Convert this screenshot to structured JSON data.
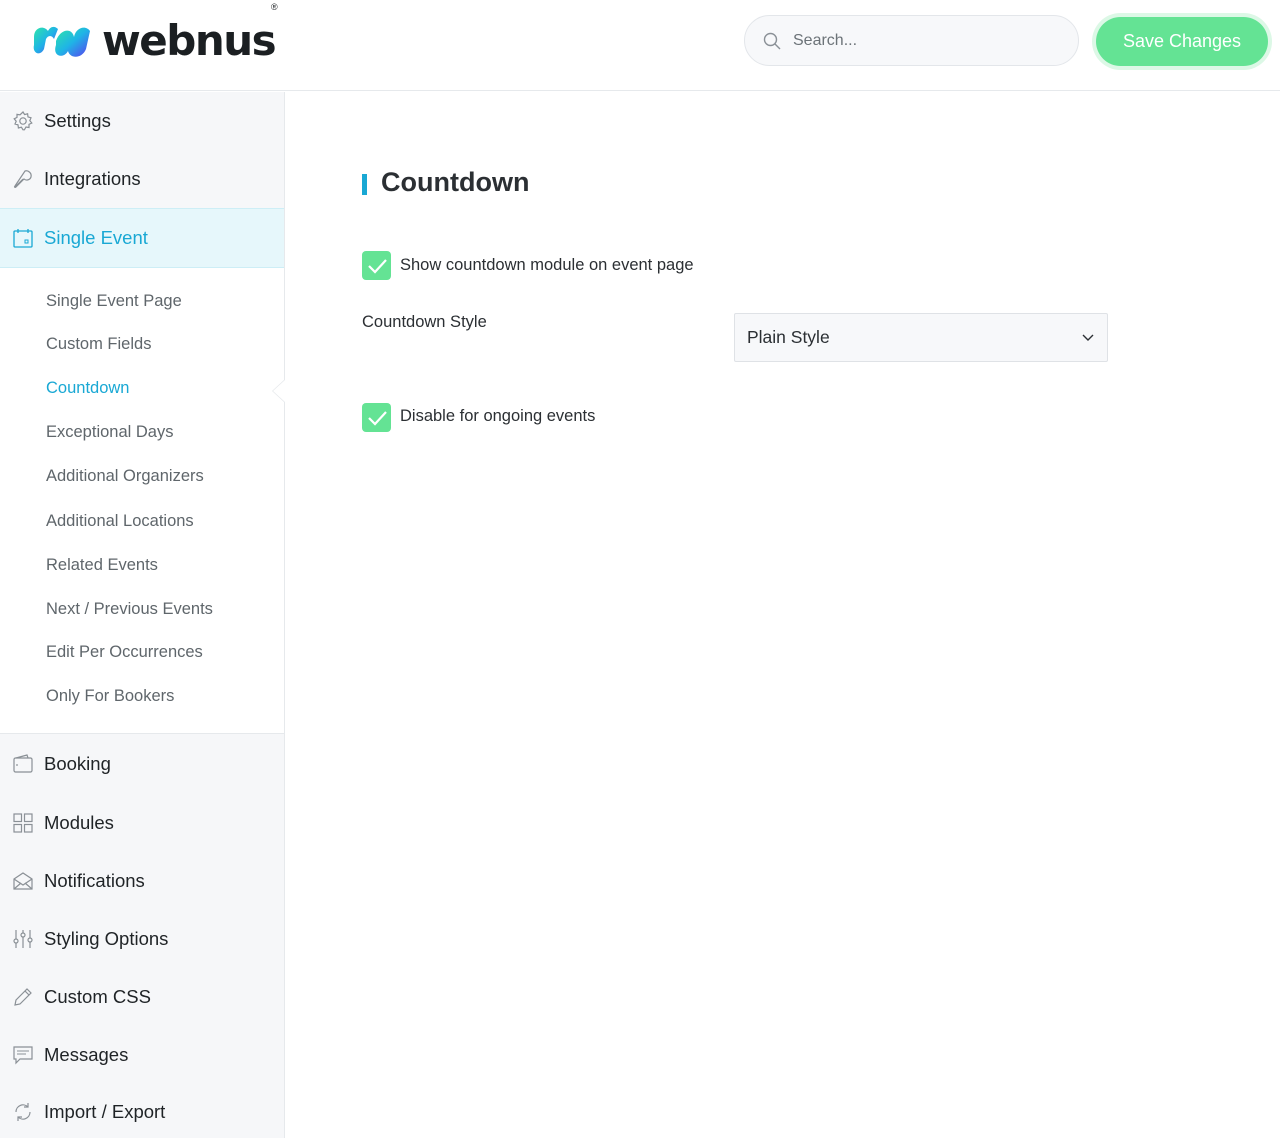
{
  "header": {
    "logo_text": "webnus",
    "logo_reg": "®",
    "search_placeholder": "Search...",
    "save_label": "Save Changes"
  },
  "sidebar": {
    "items_top": [
      {
        "label": "Settings",
        "icon": "gear-icon"
      },
      {
        "label": "Integrations",
        "icon": "wrench-icon"
      },
      {
        "label": "Single Event",
        "icon": "calendar-icon",
        "active": true
      }
    ],
    "submenu": [
      {
        "label": "Single Event Page"
      },
      {
        "label": "Custom Fields"
      },
      {
        "label": "Countdown",
        "active": true
      },
      {
        "label": "Exceptional Days"
      },
      {
        "label": "Additional Organizers"
      },
      {
        "label": "Additional Locations"
      },
      {
        "label": "Related Events"
      },
      {
        "label": "Next / Previous Events"
      },
      {
        "label": "Edit Per Occurrences"
      },
      {
        "label": "Only For Bookers"
      }
    ],
    "items_bottom": [
      {
        "label": "Booking",
        "icon": "wallet-icon"
      },
      {
        "label": "Modules",
        "icon": "grid-icon"
      },
      {
        "label": "Notifications",
        "icon": "envelope-icon"
      },
      {
        "label": "Styling Options",
        "icon": "sliders-icon"
      },
      {
        "label": "Custom CSS",
        "icon": "pencil-icon"
      },
      {
        "label": "Messages",
        "icon": "message-icon"
      },
      {
        "label": "Import / Export",
        "icon": "sync-icon"
      }
    ]
  },
  "main": {
    "title": "Countdown",
    "show_countdown": {
      "label": "Show countdown module on event page",
      "checked": true
    },
    "countdown_style": {
      "label": "Countdown Style",
      "value": "Plain Style"
    },
    "disable_ongoing": {
      "label": "Disable for ongoing events",
      "checked": true
    }
  },
  "colors": {
    "accent": "#19a8d4",
    "save_button": "#64e394",
    "checkbox": "#64e394",
    "sidebar_bg": "#f6f7f9",
    "active_bg": "#e6f7fb"
  }
}
